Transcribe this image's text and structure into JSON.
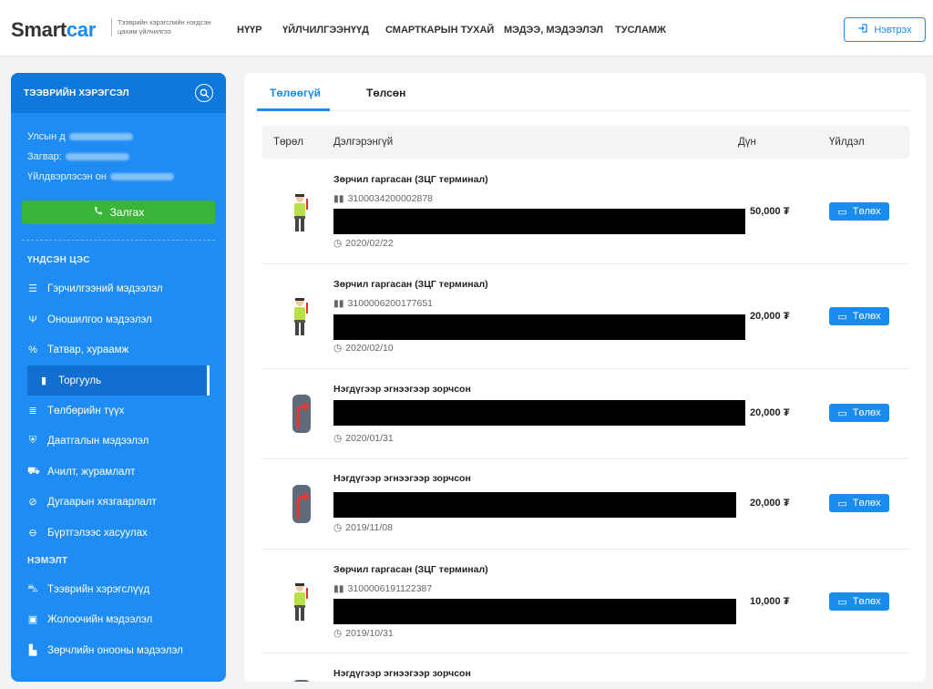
{
  "header": {
    "logo_smart": "Smart",
    "logo_car": "car",
    "tagline": "Тээврийн хэрэгслийн нэгдсэн цахим үйлчилгээ",
    "nav": [
      "НҮҮР",
      "ҮЙЛЧИЛГЭЭНҮҮД",
      "СМАРТКАРЫН ТУХАЙ",
      "МЭДЭЭ, МЭДЭЭЛЭЛ",
      "ТУСЛАМЖ"
    ],
    "login_label": "Нэвтрэх"
  },
  "sidebar": {
    "title": "ТЭЭВРИЙН ХЭРЭГСЭЛ",
    "plate_label": "Улсын д",
    "model_label": "Загвар:",
    "year_label": "Үйлдвэрлэсэн он",
    "call_label": "Залгах",
    "section_main": "ҮНДСЭН ЦЭС",
    "section_extra": "НЭМЭЛТ",
    "main_items": [
      {
        "label": "Гэрчилгээний мэдээлэл",
        "icon": "list-icon"
      },
      {
        "label": "Оношилгоо мэдээлэл",
        "icon": "stethoscope-icon"
      },
      {
        "label": "Татвар, хураамж",
        "icon": "percent-icon"
      },
      {
        "label": "Торгууль",
        "icon": "document-icon"
      },
      {
        "label": "Төлбөрийн түүх",
        "icon": "receipt-icon"
      },
      {
        "label": "Даатгалын мэдээлэл",
        "icon": "shield-icon"
      },
      {
        "label": "Ачилт, журамлалт",
        "icon": "tow-truck-icon"
      },
      {
        "label": "Дугаарын хязгаарлалт",
        "icon": "ban-icon"
      },
      {
        "label": "Бүртгэлээс хасуулах",
        "icon": "minus-circle-icon"
      }
    ],
    "extra_items": [
      {
        "label": "Тээврийн хэрэгслүүд",
        "icon": "car-icon"
      },
      {
        "label": "Жолоочийн мэдээлэл",
        "icon": "id-card-icon"
      },
      {
        "label": "Зөрчлийн онооны мэдээлэл",
        "icon": "file-icon"
      }
    ]
  },
  "tabs": {
    "unpaid": "Төлөөгүй",
    "paid": "Төлсөн"
  },
  "table": {
    "headers": {
      "type": "Төрөл",
      "detail": "Дэлгэрэнгүй",
      "amount": "Дүн",
      "action": "Үйлдэл"
    },
    "rows": [
      {
        "title": "Зөрчил гаргасан (ЗЦГ терминал)",
        "code": "3100034200002878",
        "date": "2020/02/22",
        "amount": "50,000 ₮",
        "icon": "traffic-officer-icon"
      },
      {
        "title": "Зөрчил гаргасан (ЗЦГ терминал)",
        "code": "3100006200177651",
        "date": "2020/02/10",
        "amount": "20,000 ₮",
        "icon": "traffic-officer-icon"
      },
      {
        "title": "Нэгдүгээр эгнээгээр зорчсон",
        "code": "",
        "date": "2020/01/31",
        "amount": "20,000 ₮",
        "icon": "lane-icon"
      },
      {
        "title": "Нэгдүгээр эгнээгээр зорчсон",
        "code": "",
        "date": "2019/11/08",
        "amount": "20,000 ₮",
        "icon": "lane-icon"
      },
      {
        "title": "Зөрчил гаргасан (ЗЦГ терминал)",
        "code": "3100006191122387",
        "date": "2019/10/31",
        "amount": "10,000 ₮",
        "icon": "traffic-officer-icon"
      },
      {
        "title": "Нэгдүгээр эгнээгээр зорчсон",
        "code": "",
        "date": "",
        "amount": "",
        "icon": "lane-icon"
      }
    ],
    "pay_label": "Төлөх"
  },
  "colors": {
    "accent": "#1a8cf0",
    "sidebar": "#1e8cf2",
    "call": "#3ab53a"
  }
}
